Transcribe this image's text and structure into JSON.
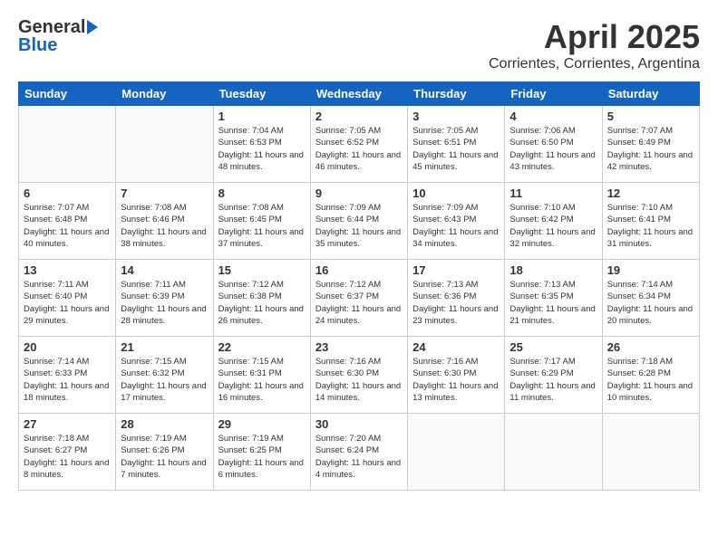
{
  "header": {
    "logo_general": "General",
    "logo_blue": "Blue",
    "title": "April 2025",
    "subtitle": "Corrientes, Corrientes, Argentina"
  },
  "weekdays": [
    "Sunday",
    "Monday",
    "Tuesday",
    "Wednesday",
    "Thursday",
    "Friday",
    "Saturday"
  ],
  "weeks": [
    [
      {
        "day": null,
        "info": null
      },
      {
        "day": null,
        "info": null
      },
      {
        "day": "1",
        "info": "Sunrise: 7:04 AM\nSunset: 6:53 PM\nDaylight: 11 hours and 48 minutes."
      },
      {
        "day": "2",
        "info": "Sunrise: 7:05 AM\nSunset: 6:52 PM\nDaylight: 11 hours and 46 minutes."
      },
      {
        "day": "3",
        "info": "Sunrise: 7:05 AM\nSunset: 6:51 PM\nDaylight: 11 hours and 45 minutes."
      },
      {
        "day": "4",
        "info": "Sunrise: 7:06 AM\nSunset: 6:50 PM\nDaylight: 11 hours and 43 minutes."
      },
      {
        "day": "5",
        "info": "Sunrise: 7:07 AM\nSunset: 6:49 PM\nDaylight: 11 hours and 42 minutes."
      }
    ],
    [
      {
        "day": "6",
        "info": "Sunrise: 7:07 AM\nSunset: 6:48 PM\nDaylight: 11 hours and 40 minutes."
      },
      {
        "day": "7",
        "info": "Sunrise: 7:08 AM\nSunset: 6:46 PM\nDaylight: 11 hours and 38 minutes."
      },
      {
        "day": "8",
        "info": "Sunrise: 7:08 AM\nSunset: 6:45 PM\nDaylight: 11 hours and 37 minutes."
      },
      {
        "day": "9",
        "info": "Sunrise: 7:09 AM\nSunset: 6:44 PM\nDaylight: 11 hours and 35 minutes."
      },
      {
        "day": "10",
        "info": "Sunrise: 7:09 AM\nSunset: 6:43 PM\nDaylight: 11 hours and 34 minutes."
      },
      {
        "day": "11",
        "info": "Sunrise: 7:10 AM\nSunset: 6:42 PM\nDaylight: 11 hours and 32 minutes."
      },
      {
        "day": "12",
        "info": "Sunrise: 7:10 AM\nSunset: 6:41 PM\nDaylight: 11 hours and 31 minutes."
      }
    ],
    [
      {
        "day": "13",
        "info": "Sunrise: 7:11 AM\nSunset: 6:40 PM\nDaylight: 11 hours and 29 minutes."
      },
      {
        "day": "14",
        "info": "Sunrise: 7:11 AM\nSunset: 6:39 PM\nDaylight: 11 hours and 28 minutes."
      },
      {
        "day": "15",
        "info": "Sunrise: 7:12 AM\nSunset: 6:38 PM\nDaylight: 11 hours and 26 minutes."
      },
      {
        "day": "16",
        "info": "Sunrise: 7:12 AM\nSunset: 6:37 PM\nDaylight: 11 hours and 24 minutes."
      },
      {
        "day": "17",
        "info": "Sunrise: 7:13 AM\nSunset: 6:36 PM\nDaylight: 11 hours and 23 minutes."
      },
      {
        "day": "18",
        "info": "Sunrise: 7:13 AM\nSunset: 6:35 PM\nDaylight: 11 hours and 21 minutes."
      },
      {
        "day": "19",
        "info": "Sunrise: 7:14 AM\nSunset: 6:34 PM\nDaylight: 11 hours and 20 minutes."
      }
    ],
    [
      {
        "day": "20",
        "info": "Sunrise: 7:14 AM\nSunset: 6:33 PM\nDaylight: 11 hours and 18 minutes."
      },
      {
        "day": "21",
        "info": "Sunrise: 7:15 AM\nSunset: 6:32 PM\nDaylight: 11 hours and 17 minutes."
      },
      {
        "day": "22",
        "info": "Sunrise: 7:15 AM\nSunset: 6:31 PM\nDaylight: 11 hours and 16 minutes."
      },
      {
        "day": "23",
        "info": "Sunrise: 7:16 AM\nSunset: 6:30 PM\nDaylight: 11 hours and 14 minutes."
      },
      {
        "day": "24",
        "info": "Sunrise: 7:16 AM\nSunset: 6:30 PM\nDaylight: 11 hours and 13 minutes."
      },
      {
        "day": "25",
        "info": "Sunrise: 7:17 AM\nSunset: 6:29 PM\nDaylight: 11 hours and 11 minutes."
      },
      {
        "day": "26",
        "info": "Sunrise: 7:18 AM\nSunset: 6:28 PM\nDaylight: 11 hours and 10 minutes."
      }
    ],
    [
      {
        "day": "27",
        "info": "Sunrise: 7:18 AM\nSunset: 6:27 PM\nDaylight: 11 hours and 8 minutes."
      },
      {
        "day": "28",
        "info": "Sunrise: 7:19 AM\nSunset: 6:26 PM\nDaylight: 11 hours and 7 minutes."
      },
      {
        "day": "29",
        "info": "Sunrise: 7:19 AM\nSunset: 6:25 PM\nDaylight: 11 hours and 6 minutes."
      },
      {
        "day": "30",
        "info": "Sunrise: 7:20 AM\nSunset: 6:24 PM\nDaylight: 11 hours and 4 minutes."
      },
      {
        "day": null,
        "info": null
      },
      {
        "day": null,
        "info": null
      },
      {
        "day": null,
        "info": null
      }
    ]
  ]
}
